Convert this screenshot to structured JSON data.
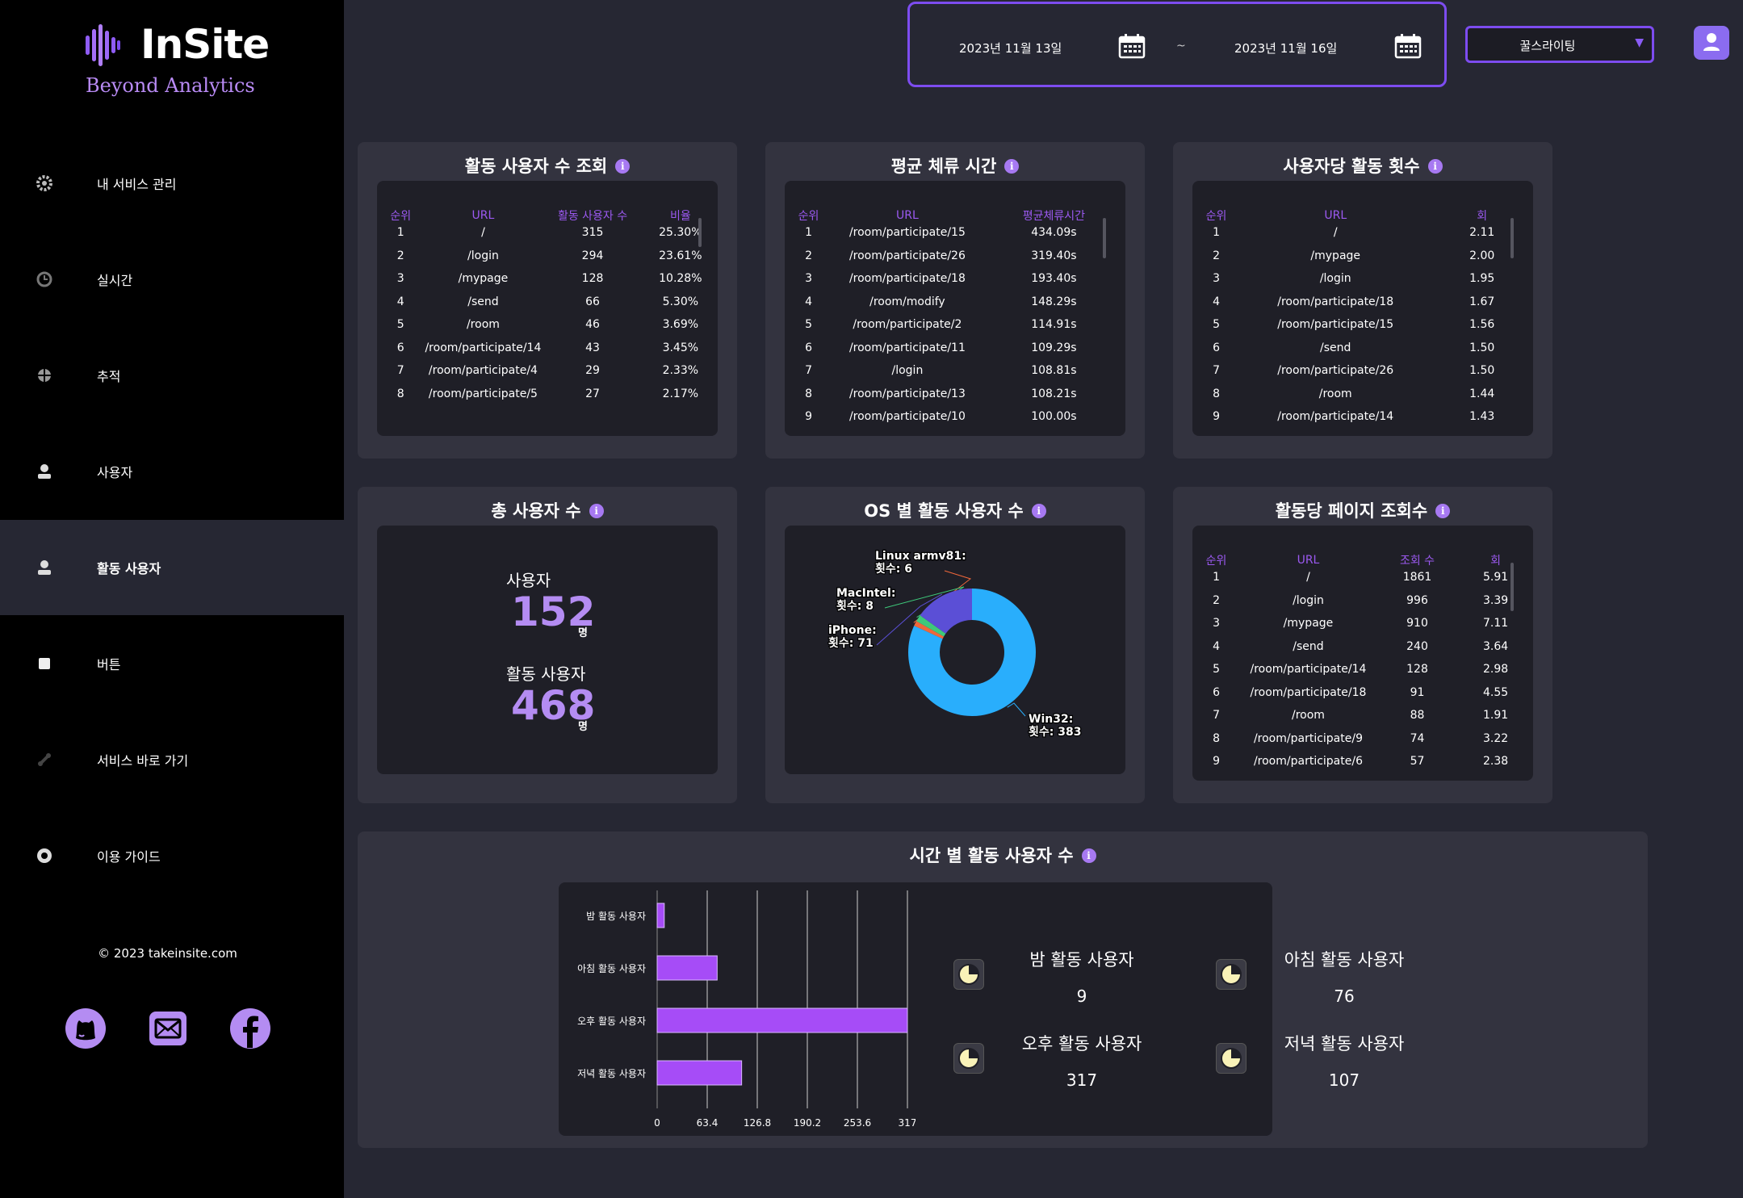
{
  "brand": {
    "title": "InSite",
    "subtitle": "Beyond Analytics"
  },
  "sidebar": {
    "items": [
      {
        "label": "내 서비스 관리",
        "icon": "gear-icon"
      },
      {
        "label": "실시간",
        "icon": "clock-icon"
      },
      {
        "label": "추적",
        "icon": "crosshair-icon"
      },
      {
        "label": "사용자",
        "icon": "user-icon"
      },
      {
        "label": "활동 사용자",
        "icon": "user-icon"
      },
      {
        "label": "버튼",
        "icon": "square-icon"
      },
      {
        "label": "서비스 바로 가기",
        "icon": "link-icon"
      },
      {
        "label": "이용 가이드",
        "icon": "help-icon"
      }
    ],
    "active_index": 4,
    "copyright": "© 2023 takeinsite.com"
  },
  "header": {
    "start_date": "2023년 11월 13일",
    "end_date": "2023년 11월 16일",
    "separator": "~",
    "service": "꿀스라이팅"
  },
  "accent_color": "#7d4cf0",
  "active_users_table": {
    "title": "활동 사용자 수 조회",
    "headers": [
      "순위",
      "URL",
      "활동 사용자 수",
      "비율"
    ],
    "rows": [
      [
        "1",
        "/",
        "315",
        "25.30%"
      ],
      [
        "2",
        "/login",
        "294",
        "23.61%"
      ],
      [
        "3",
        "/mypage",
        "128",
        "10.28%"
      ],
      [
        "4",
        "/send",
        "66",
        "5.30%"
      ],
      [
        "5",
        "/room",
        "46",
        "3.69%"
      ],
      [
        "6",
        "/room/participate/14",
        "43",
        "3.45%"
      ],
      [
        "7",
        "/room/participate/4",
        "29",
        "2.33%"
      ],
      [
        "8",
        "/room/participate/5",
        "27",
        "2.17%"
      ]
    ]
  },
  "avg_stay_table": {
    "title": "평균 체류 시간",
    "headers": [
      "순위",
      "URL",
      "평균체류시간"
    ],
    "rows": [
      [
        "1",
        "/room/participate/15",
        "434.09s"
      ],
      [
        "2",
        "/room/participate/26",
        "319.40s"
      ],
      [
        "3",
        "/room/participate/18",
        "193.40s"
      ],
      [
        "4",
        "/room/modify",
        "148.29s"
      ],
      [
        "5",
        "/room/participate/2",
        "114.91s"
      ],
      [
        "6",
        "/room/participate/11",
        "109.29s"
      ],
      [
        "7",
        "/login",
        "108.81s"
      ],
      [
        "8",
        "/room/participate/13",
        "108.21s"
      ],
      [
        "9",
        "/room/participate/10",
        "100.00s"
      ]
    ]
  },
  "activity_per_user_table": {
    "title": "사용자당 활동 횟수",
    "headers": [
      "순위",
      "URL",
      "회"
    ],
    "rows": [
      [
        "1",
        "/",
        "2.11"
      ],
      [
        "2",
        "/mypage",
        "2.00"
      ],
      [
        "3",
        "/login",
        "1.95"
      ],
      [
        "4",
        "/room/participate/18",
        "1.67"
      ],
      [
        "5",
        "/room/participate/15",
        "1.56"
      ],
      [
        "6",
        "/send",
        "1.50"
      ],
      [
        "7",
        "/room/participate/26",
        "1.50"
      ],
      [
        "8",
        "/room",
        "1.44"
      ],
      [
        "9",
        "/room/participate/14",
        "1.43"
      ]
    ]
  },
  "total_users": {
    "title": "총 사용자 수",
    "users_label": "사용자",
    "users_value": "152",
    "active_label": "활동 사용자",
    "active_value": "468",
    "unit": "명"
  },
  "os_chart": {
    "title": "OS 별 활동 사용자 수",
    "chart_data": {
      "type": "pie",
      "donut": true,
      "slices": [
        {
          "label": "Win32:",
          "count_label": "횟수: 383",
          "value": 383,
          "color": "#29aefc"
        },
        {
          "label": "iPhone:",
          "count_label": "횟수: 71",
          "value": 71,
          "color": "#5b4fd6"
        },
        {
          "label": "MacIntel:",
          "count_label": "횟수: 8",
          "value": 8,
          "color": "#3ec97a"
        },
        {
          "label": "Linux armv81:",
          "count_label": "횟수: 6",
          "value": 6,
          "color": "#f0673a"
        }
      ]
    }
  },
  "page_views_table": {
    "title": "활동당 페이지 조회수",
    "headers": [
      "순위",
      "URL",
      "조회 수",
      "회"
    ],
    "rows": [
      [
        "1",
        "/",
        "1861",
        "5.91"
      ],
      [
        "2",
        "/login",
        "996",
        "3.39"
      ],
      [
        "3",
        "/mypage",
        "910",
        "7.11"
      ],
      [
        "4",
        "/send",
        "240",
        "3.64"
      ],
      [
        "5",
        "/room/participate/14",
        "128",
        "2.98"
      ],
      [
        "6",
        "/room/participate/18",
        "91",
        "4.55"
      ],
      [
        "7",
        "/room",
        "88",
        "1.91"
      ],
      [
        "8",
        "/room/participate/9",
        "74",
        "3.22"
      ],
      [
        "9",
        "/room/participate/6",
        "57",
        "2.38"
      ]
    ]
  },
  "hourly": {
    "title": "시간 별 활동 사용자 수",
    "chart_data": {
      "type": "bar",
      "orientation": "horizontal",
      "categories": [
        "밤 활동 사용자",
        "아침 활동 사용자",
        "오후 활동 사용자",
        "저녁 활동 사용자"
      ],
      "values": [
        9,
        76,
        317,
        107
      ],
      "xlim": [
        0,
        317
      ],
      "xticks": [
        "0",
        "63.4",
        "126.8",
        "190.2",
        "253.6",
        "317"
      ],
      "bar_color": "#a64cf7"
    },
    "summary": [
      {
        "label": "밤 활동 사용자",
        "value": "9"
      },
      {
        "label": "아침 활동 사용자",
        "value": "76"
      },
      {
        "label": "오후 활동 사용자",
        "value": "317"
      },
      {
        "label": "저녁 활동 사용자",
        "value": "107"
      }
    ]
  }
}
